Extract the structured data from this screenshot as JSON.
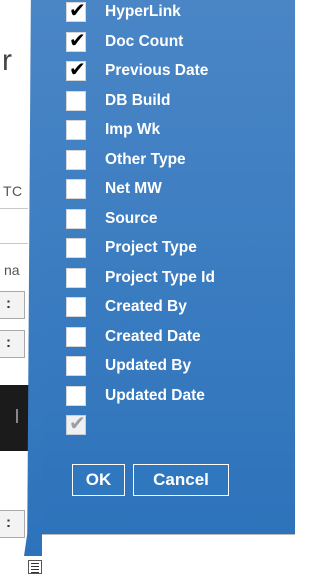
{
  "background": {
    "letter_r": "r",
    "tc_text": "TC",
    "na_text": "na",
    "box1_text": ":",
    "box2_text": ":"
  },
  "column_chooser": {
    "items": [
      {
        "label": "HyperLink",
        "checked": true
      },
      {
        "label": "Doc Count",
        "checked": true
      },
      {
        "label": "Previous Date",
        "checked": true
      },
      {
        "label": "DB Build",
        "checked": false
      },
      {
        "label": "Imp Wk",
        "checked": false
      },
      {
        "label": "Other Type",
        "checked": false
      },
      {
        "label": "Net MW",
        "checked": false
      },
      {
        "label": "Source",
        "checked": false
      },
      {
        "label": "Project Type",
        "checked": false
      },
      {
        "label": "Project Type Id",
        "checked": false
      },
      {
        "label": "Created By",
        "checked": false
      },
      {
        "label": "Created Date",
        "checked": false
      },
      {
        "label": "Updated By",
        "checked": false
      },
      {
        "label": "Updated Date",
        "checked": false
      }
    ],
    "disabled_item_checked": true,
    "ok_label": "OK",
    "cancel_label": "Cancel"
  },
  "icons": {
    "check": "checkmark-icon",
    "grip": "list-grip-icon"
  },
  "colors": {
    "panel_top": "#4a86c6",
    "panel_bottom": "#2d73bb",
    "label_text": "#ffffff"
  }
}
